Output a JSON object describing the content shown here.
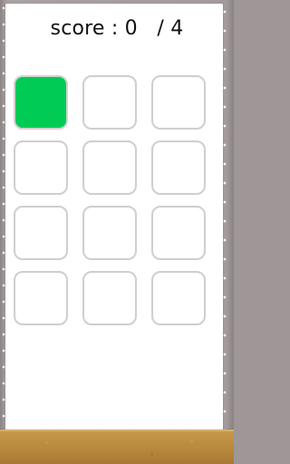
{
  "game": {
    "score_text": "score : 0   / 4",
    "active_color": "#00cc55",
    "cell_border_color": "#cfcfcf",
    "active_cell_index": 0,
    "board_rows": 4,
    "board_cols": 3
  }
}
